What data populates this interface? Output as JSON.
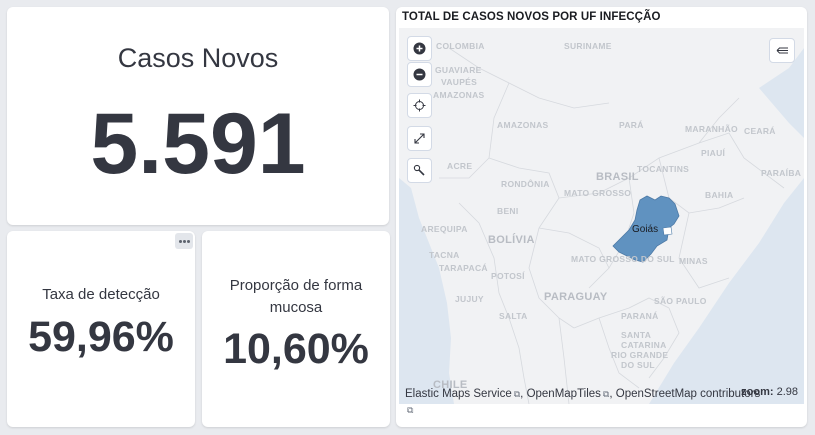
{
  "casos_novos": {
    "label": "Casos Novos",
    "value": "5.591"
  },
  "taxa_deteccao": {
    "label": "Taxa de detecção",
    "value": "59,96%"
  },
  "proporcao_mucosa": {
    "label": "Proporção de forma mucosa",
    "value": "10,60%"
  },
  "map": {
    "title": "TOTAL DE CASOS NOVOS POR UF INFECÇÃO",
    "highlight_state": "Goiás",
    "highlight_color": "#6092c0",
    "zoom_label": "zoom:",
    "zoom_value": "2.98",
    "attribution": [
      "Elastic Maps Service",
      "OpenMapTiles",
      "OpenStreetMap contributors"
    ],
    "controls": [
      "plus-icon",
      "minus-icon",
      "crosshair-icon",
      "expand-icon",
      "wrench-icon",
      "legend-collapse-icon"
    ],
    "places": {
      "colombia": "COLOMBIA",
      "suriname": "SURINAME",
      "guaviare": "GUAVIARE",
      "vaupes": "VAUPÉS",
      "amazonas_co": "AMAZONAS",
      "amazonas": "AMAZONAS",
      "para": "PARÁ",
      "maranhao": "MARANHÃO",
      "ceara": "CEARÁ",
      "piaui": "PIAUÍ",
      "paraiba": "PARAÍBA",
      "acre": "ACRE",
      "tocantins": "TOCANTINS",
      "brasil": "BRASIL",
      "bahia": "BAHIA",
      "rondonia": "RONDÔNIA",
      "mato_grosso": "MATO GROSSO",
      "beni": "BENI",
      "arequipa": "AREQUIPA",
      "bolivia": "BOLÍVIA",
      "tacna": "TACNA",
      "tarapaca": "TARAPACÁ",
      "mato_grosso_do_sul": "MATO GROSSO DO SUL",
      "paraguay": "PARAGUAY",
      "sao_paulo": "SÃO PAULO",
      "jujuy": "JUJUY",
      "salta": "SALTA",
      "parana": "PARANÁ",
      "catarina": "CATARINA",
      "santa": "SANTA",
      "grande": "GRANDE",
      "rio_grande": "RIO GRANDE",
      "do_sul": "DO SUL",
      "chile": "CHILE",
      "potosi": "POTOSÍ",
      "minas": "MINAS"
    }
  }
}
